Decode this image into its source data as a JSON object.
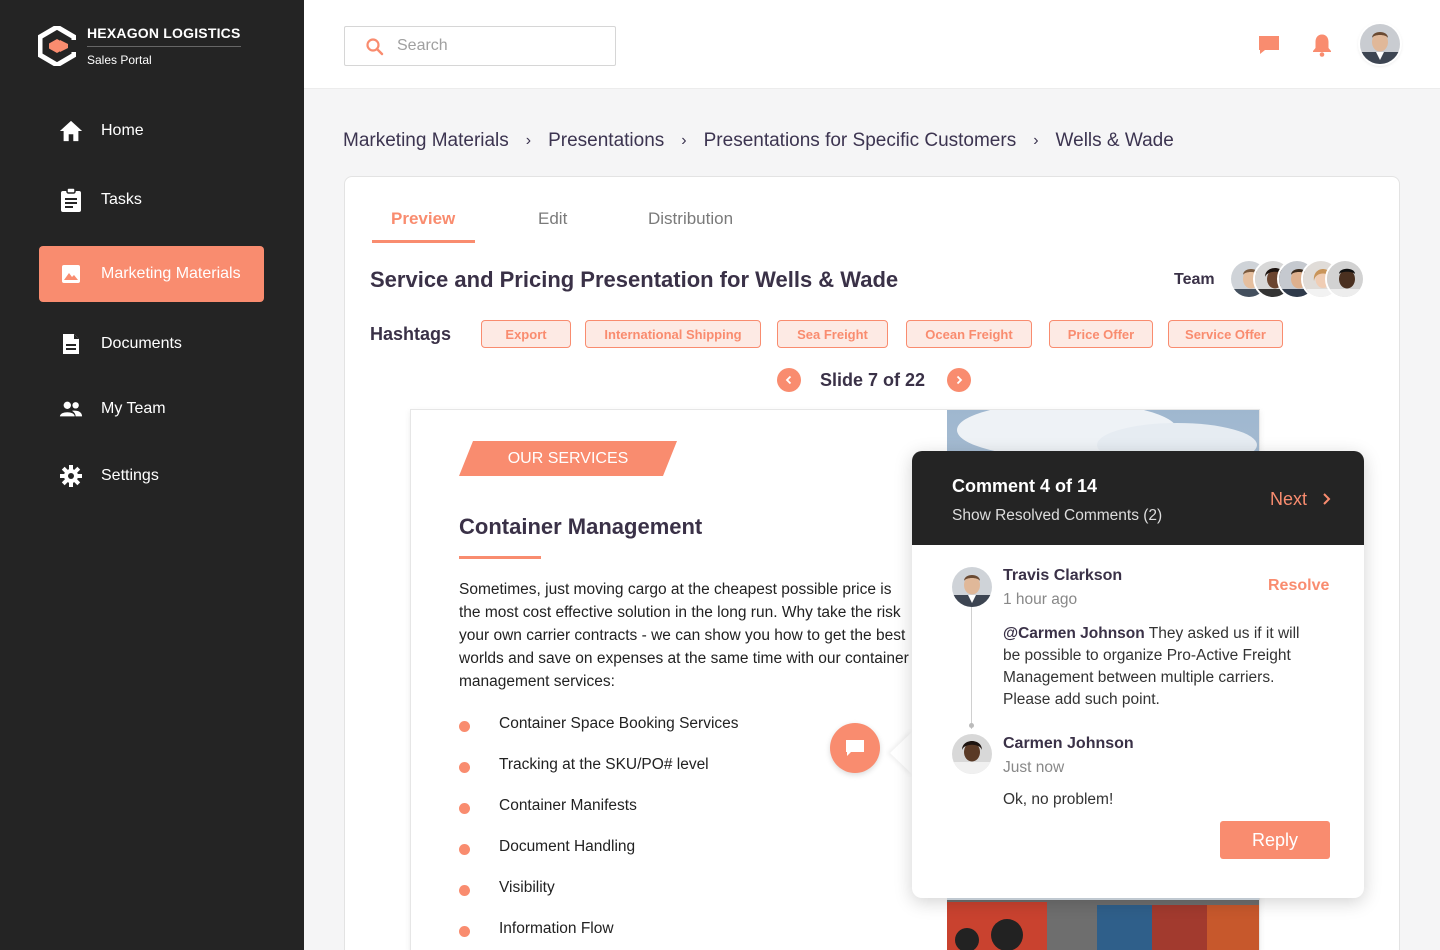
{
  "brand": {
    "name": "HEXAGON LOGISTICS",
    "subtitle": "Sales Portal"
  },
  "sidebar": {
    "items": [
      {
        "label": "Home",
        "icon": "home-icon"
      },
      {
        "label": "Tasks",
        "icon": "clipboard-icon"
      },
      {
        "label": "Marketing Materials",
        "icon": "image-icon",
        "active": true
      },
      {
        "label": "Documents",
        "icon": "document-icon"
      },
      {
        "label": "My Team",
        "icon": "team-icon"
      },
      {
        "label": "Settings",
        "icon": "gear-icon"
      }
    ]
  },
  "header": {
    "search_placeholder": "Search",
    "icons": [
      "chat-icon",
      "bell-icon",
      "avatar"
    ]
  },
  "breadcrumb": [
    "Marketing Materials",
    "Presentations",
    "Presentations for Specific Customers",
    "Wells & Wade"
  ],
  "tabs": [
    {
      "label": "Preview",
      "active": true
    },
    {
      "label": "Edit"
    },
    {
      "label": "Distribution"
    }
  ],
  "presentation": {
    "title": "Service and Pricing Presentation for Wells & Wade",
    "team_label": "Team",
    "hashtags_label": "Hashtags",
    "hashtags": [
      "Export",
      "International Shipping",
      "Sea Freight",
      "Ocean Freight",
      "Price Offer",
      "Service Offer"
    ],
    "slide_counter": "Slide 7 of 22"
  },
  "slide": {
    "ribbon": "OUR SERVICES",
    "heading": "Container Management",
    "body_lines": [
      "Sometimes, just moving cargo at the cheapest possible price is",
      "the most cost effective solution in the long run. Why take the risk",
      "your own carrier contracts - we can show you how to get the best",
      "worlds and save on expenses at the same time with our container",
      "management services:"
    ],
    "bullets": [
      "Container Space Booking Services",
      "Tracking at the SKU/PO# level",
      "Container Manifests",
      "Document Handling",
      "Visibility",
      "Information Flow"
    ]
  },
  "comments": {
    "title": "Comment 4 of 14",
    "resolved_link": "Show Resolved Comments (2)",
    "next_label": "Next",
    "resolve_label": "Resolve",
    "reply_label": "Reply",
    "thread": [
      {
        "author": "Travis Clarkson",
        "time": "1 hour ago",
        "mention": "@Carmen Johnson",
        "text_lines": [
          "They asked us if it will",
          "be possible to organize Pro-Active Freight",
          "Management between multiple carriers.",
          "Please add such point."
        ]
      },
      {
        "author": "Carmen Johnson",
        "time": "Just now",
        "text": "Ok, no problem!"
      }
    ]
  },
  "colors": {
    "accent": "#f98c6f",
    "sidebar_bg": "#242424",
    "title_text": "#3a3147"
  }
}
